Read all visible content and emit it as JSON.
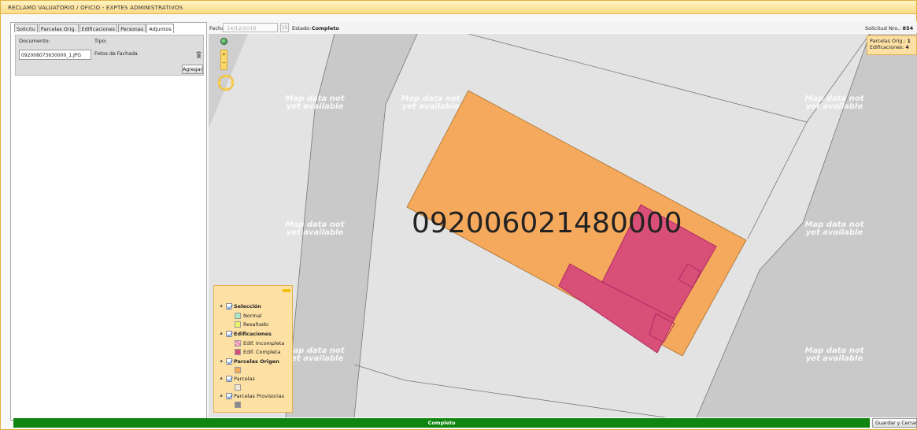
{
  "window": {
    "title": "RECLAMO VALUATORIO / OFICIO  -  EXPTES ADMINISTRATIVOS"
  },
  "tabs": [
    {
      "label": "Solicitu"
    },
    {
      "label": "Parcelas Orig."
    },
    {
      "label": "Edificaciones"
    },
    {
      "label": "Personas"
    },
    {
      "label": "Adjuntos"
    }
  ],
  "attachments": {
    "doc_header": "Documento:",
    "type_header": "Tipo:",
    "doc_value": "092008073630000_1.JPG",
    "type_value": "Fotos de Fachada",
    "add_label": "Agregar"
  },
  "header": {
    "fecha_label": "Fecha:",
    "fecha_value": "14/12/2016",
    "calendar_icon": "calendar-icon",
    "calendar_text": "15",
    "estado_label": "Estado:",
    "estado_value": "Completo",
    "solicitud_label": "Solicitud Nro.:",
    "solicitud_value": "854"
  },
  "counts": {
    "parcelas_label": "Parcelas Orig.:",
    "parcelas_value": "1",
    "edif_label": "Edificaciones:",
    "edif_value": "4"
  },
  "map": {
    "parcel_label": "092006021480000",
    "tile_line1": "Map data not",
    "tile_line2": "yet available",
    "colors": {
      "parcel": "#f5a95c",
      "building": "#d84f78",
      "road": "#c8c8c8",
      "block": "#e3e3e3"
    }
  },
  "legend": {
    "seleccion": "Selección",
    "normal": "Normal",
    "resaltado": "Resaltado",
    "edificaciones": "Edificaciones",
    "edif_incompleta": "Edif. Incompleta",
    "edif_completa": "Edif. Completa",
    "parcelas_origen": "Parcelas Origen",
    "parcelas": "Parcelas",
    "parcelas_provisorias": "Parcelas Provisorias"
  },
  "footer": {
    "status": "Completo",
    "save_label": "Guardar y Cerrar"
  }
}
